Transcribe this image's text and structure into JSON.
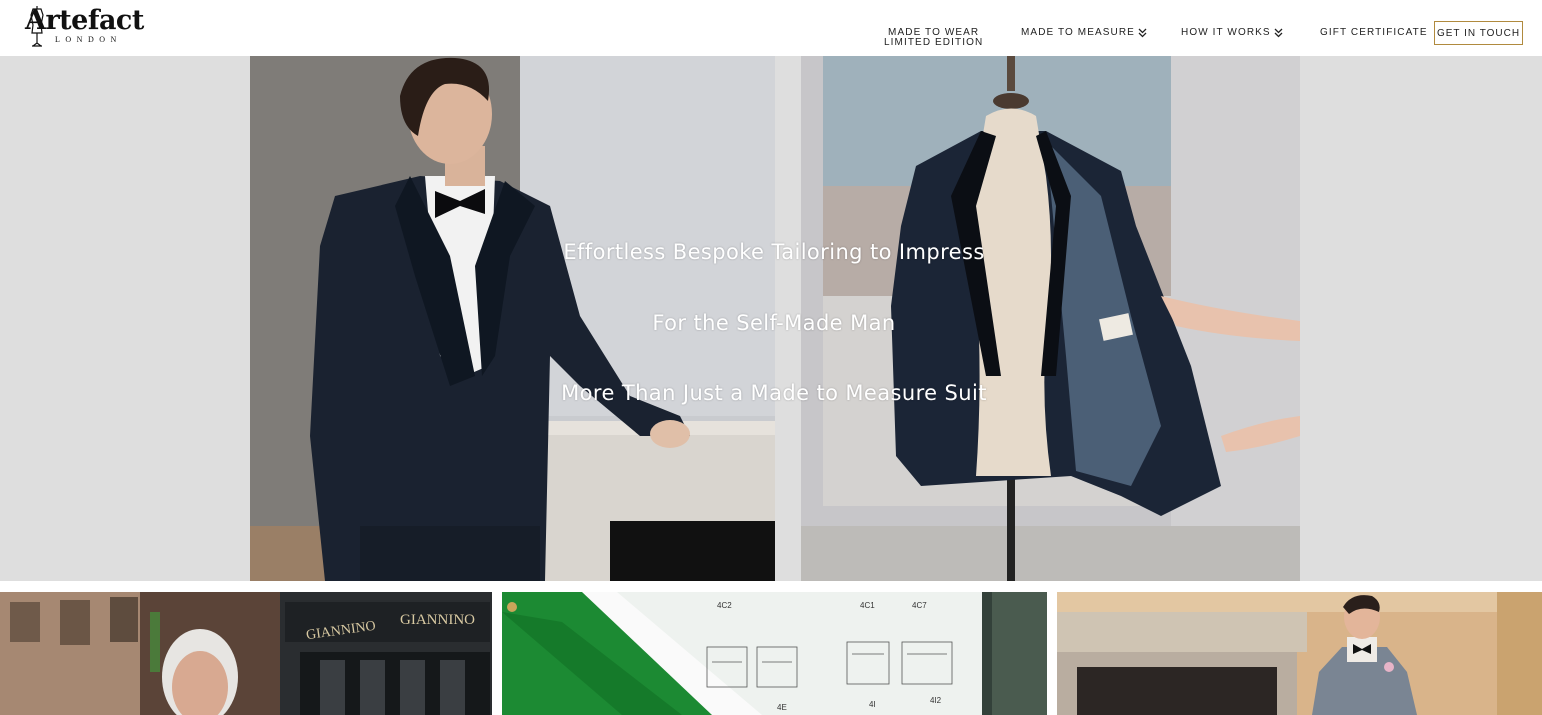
{
  "brand": {
    "wordmark": "Artefact",
    "sub": "LONDON"
  },
  "nav": {
    "made_to_wear_line1": "MADE TO WEAR",
    "made_to_wear_line2": "LIMITED EDITION",
    "made_to_measure": "MADE TO MEASURE",
    "how_it_works": "HOW IT WORKS",
    "gift_certificate": "GIFT CERTIFICATE",
    "get_in_touch": "GET IN TOUCH"
  },
  "icons": {
    "dropdown": "double-chevron-down-icon",
    "logo": "mannequin-icon"
  },
  "hero": {
    "line1": "Effortless Bespoke Tailoring to Impress",
    "line2": "For the Self-Made Man",
    "line3": "More Than Just a Made to Measure Suit"
  },
  "thumbnails": {
    "shop_sign": "GIANNINO",
    "pattern_labels": [
      "4C2",
      "4C1",
      "4C7",
      "4E",
      "4I",
      "4I2"
    ]
  },
  "colors": {
    "accent_border": "#b08a3e",
    "hero_background": "#dedede",
    "text": "#222222"
  }
}
